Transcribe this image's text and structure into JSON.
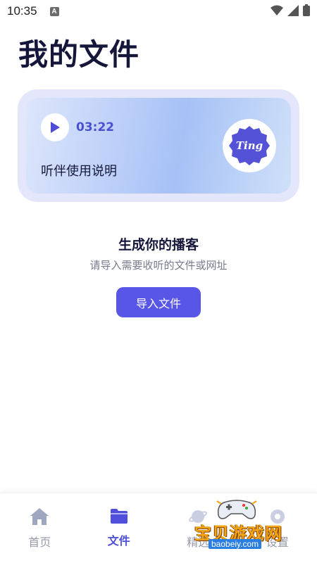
{
  "status_bar": {
    "time": "10:35",
    "notif_letter": "A"
  },
  "page": {
    "title": "我的文件"
  },
  "player_card": {
    "duration": "03:22",
    "title": "听伴使用说明",
    "logo_text": "Ting",
    "accent_color": "#5453d8"
  },
  "empty_state": {
    "title": "生成你的播客",
    "subtitle": "请导入需要收听的文件或网址",
    "button_label": "导入文件",
    "button_color": "#5856e6"
  },
  "tab_bar": {
    "items": [
      {
        "label": "首页",
        "icon": "home-icon",
        "active": false
      },
      {
        "label": "文件",
        "icon": "folder-icon",
        "active": true
      },
      {
        "label": "精选",
        "icon": "planet-icon",
        "active": false
      },
      {
        "label": "设置",
        "icon": "settings-icon",
        "active": false
      }
    ]
  },
  "watermark": {
    "text": "宝贝游戏网",
    "url": "baobeiy.com"
  }
}
